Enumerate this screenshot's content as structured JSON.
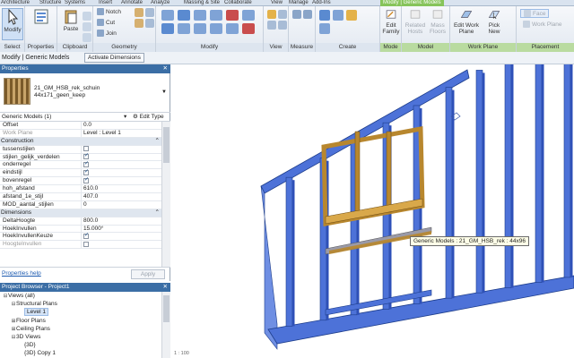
{
  "tabs": [
    "Architecture",
    "Structure",
    "Systems",
    "Insert",
    "Annotate",
    "Analyze",
    "Massing & Site",
    "Collaborate",
    "View",
    "Manage",
    "Add-Ins"
  ],
  "context_tab": "Modify | Generic Models",
  "ribbon": {
    "modify_label": "Modify",
    "select_label": "Select",
    "properties_label": "Properties",
    "clipboard_label": "Clipboard",
    "paste_label": "Paste",
    "geometry_label": "Geometry",
    "notch_label": "Notch",
    "cut_label": "Cut",
    "join_label": "Join",
    "modify_group_label": "Modify",
    "view_label": "View",
    "measure_label": "Measure",
    "create_label": "Create",
    "edit_family": "Edit Family",
    "mode_label": "Mode",
    "related_hosts": "Related Hosts",
    "mass_floors": "Mass Floors",
    "model_label": "Model",
    "edit_work_plane": "Edit Work Plane",
    "work_plane_label": "Work Plane",
    "pick_new": "Pick New",
    "face_label": "Face",
    "work_plane_option": "Work Plane",
    "placement_label": "Placement"
  },
  "optbar": {
    "mode": "Modify | Generic Models",
    "activate": "Activate Dimensions"
  },
  "properties": {
    "title": "Properties",
    "type_name": "21_GM_HSB_rek_schuin",
    "type_sub": "44x171_geen_keep",
    "selection": "Generic Models (1)",
    "edit_type": "Edit Type",
    "rows": [
      {
        "k": "Offset",
        "v": "0.0"
      },
      {
        "k": "Work Plane",
        "v": "Level : Level 1",
        "dis": true
      }
    ],
    "construction": "Construction",
    "crows": [
      {
        "k": "tussenstijlen",
        "v": false
      },
      {
        "k": "stijlen_gelijk_verdelen",
        "v": true
      },
      {
        "k": "onderregel",
        "v": true
      },
      {
        "k": "eindstijl",
        "v": true
      },
      {
        "k": "bovenregel",
        "v": true
      }
    ],
    "vrows": [
      {
        "k": "hoh_afstand",
        "v": "610.0"
      },
      {
        "k": "afstand_1e_stijl",
        "v": "407.0"
      },
      {
        "k": "MOD_aantal_stijlen",
        "v": "0"
      }
    ],
    "dimensions": "Dimensions",
    "drows": [
      {
        "k": "DeltaHoogte",
        "v": "800.0"
      },
      {
        "k": "HoekInvullen",
        "v": "15.000°"
      }
    ],
    "keuze": "HoekInvullenKeuze",
    "hoogte": "HoogteInvullen",
    "help": "Properties help",
    "apply": "Apply"
  },
  "browser": {
    "title": "Project Browser - Project1",
    "nodes": [
      {
        "t": "Views (all)",
        "d": 0,
        "tw": "⊟"
      },
      {
        "t": "Structural Plans",
        "d": 1,
        "tw": "⊟"
      },
      {
        "t": "Level 1",
        "d": 2,
        "tw": "",
        "sel": true
      },
      {
        "t": "Floor Plans",
        "d": 1,
        "tw": "⊞"
      },
      {
        "t": "Ceiling Plans",
        "d": 1,
        "tw": "⊞"
      },
      {
        "t": "3D Views",
        "d": 1,
        "tw": "⊟"
      },
      {
        "t": "{3D}",
        "d": 2,
        "tw": ""
      },
      {
        "t": "{3D} Copy 1",
        "d": 2,
        "tw": ""
      }
    ]
  },
  "tooltip": "Generic Models : 21_GM_HSB_rek : 44x96",
  "status": "1 : 100",
  "colors": {
    "blue_stud": "#4d72d8",
    "wood": "#b8872e",
    "selection": "#3b6ea5",
    "context_green": "#86c45a"
  }
}
